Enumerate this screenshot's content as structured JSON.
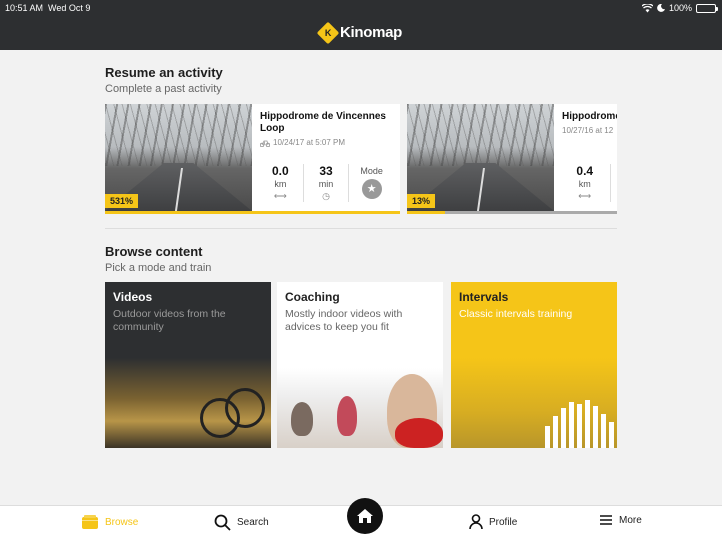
{
  "status": {
    "time": "10:51 AM",
    "date": "Wed Oct 9",
    "battery": "100%"
  },
  "header": {
    "brand": "Kinomap",
    "logo_letter": "K"
  },
  "resume": {
    "title": "Resume an activity",
    "subtitle": "Complete a past activity",
    "cards": [
      {
        "name": "Hippodrome de Vincennes Loop",
        "date": "10/24/17 at 5:07 PM",
        "distance": "0.0",
        "distance_unit": "km",
        "duration": "33",
        "duration_unit": "min",
        "mode_label": "Mode",
        "percent": "531%",
        "progress": 1.0
      },
      {
        "name": "Hippodrome de Vincennes L",
        "date": "10/27/16 at 12",
        "distance": "0.4",
        "distance_unit": "km",
        "percent": "13%",
        "progress": 0.13
      }
    ]
  },
  "browse": {
    "title": "Browse content",
    "subtitle": "Pick a mode and train",
    "tiles": [
      {
        "title": "Videos",
        "desc": "Outdoor videos from the community"
      },
      {
        "title": "Coaching",
        "desc": "Mostly indoor videos with advices to keep you fit"
      },
      {
        "title": "Intervals",
        "desc": "Classic intervals training"
      }
    ]
  },
  "nav": {
    "browse": "Browse",
    "search": "Search",
    "profile": "Profile",
    "more": "More"
  },
  "colors": {
    "accent": "#f5c518",
    "dark": "#2d2f31"
  }
}
